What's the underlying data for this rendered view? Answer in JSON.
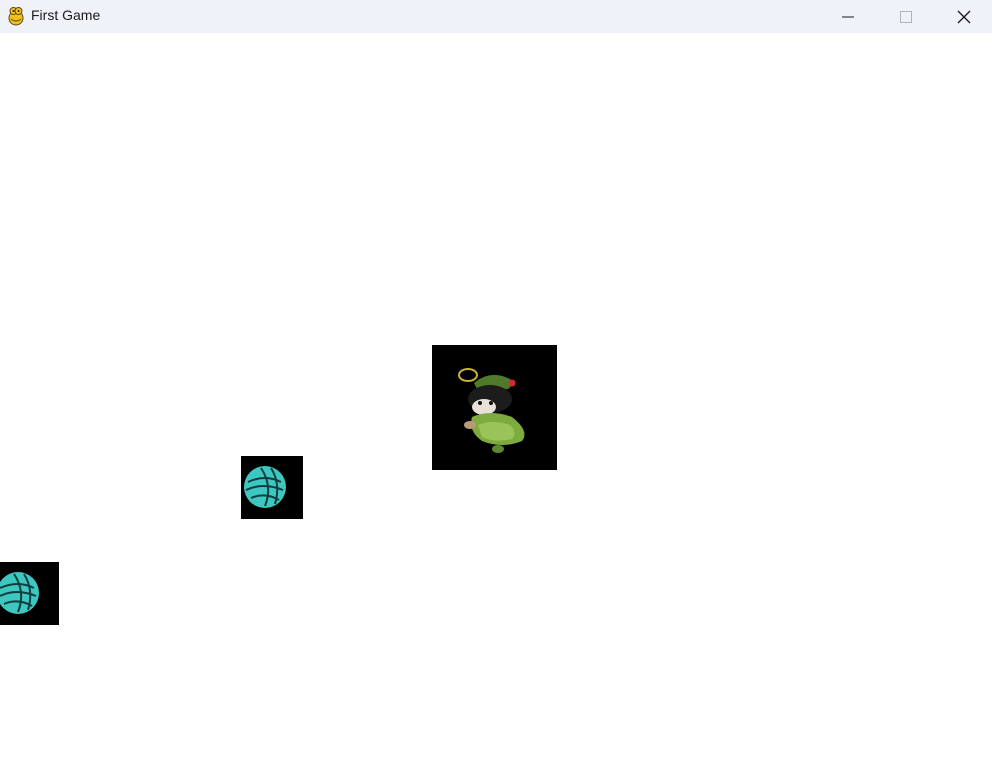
{
  "window": {
    "title": "First Game",
    "icon": "pygame-snake-icon",
    "controls": [
      "minimize-icon",
      "maximize-icon",
      "close-icon"
    ]
  },
  "game": {
    "background": "#ffffff",
    "sprites": [
      {
        "name": "player-crochet-doll",
        "icon": "crochet-doll-sprite"
      },
      {
        "name": "yarn-ball",
        "icon": "yarn-ball-sprite",
        "color": "#3ec6c0"
      },
      {
        "name": "yarn-ball",
        "icon": "yarn-ball-sprite",
        "color": "#3ec6c0"
      }
    ]
  }
}
